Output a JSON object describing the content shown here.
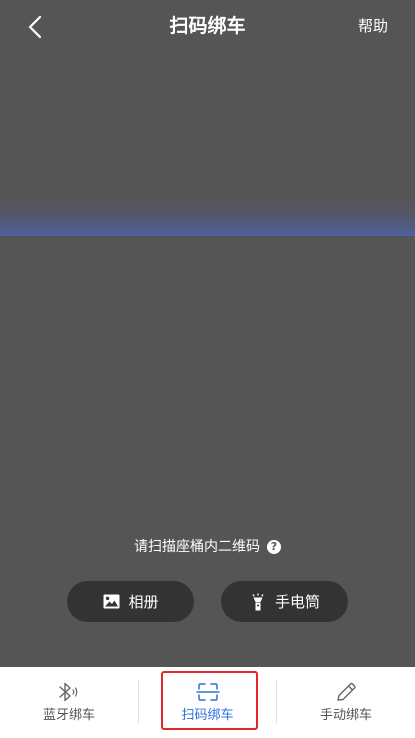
{
  "header": {
    "title": "扫码绑车",
    "help_label": "帮助"
  },
  "scan": {
    "hint": "请扫描座桶内二维码",
    "hint_icon_glyph": "?"
  },
  "actions": {
    "album_label": "相册",
    "torch_label": "手电筒"
  },
  "tabbar": {
    "items": [
      {
        "label": "蓝牙绑车",
        "icon": "bluetooth-icon",
        "active": false
      },
      {
        "label": "扫码绑车",
        "icon": "scan-icon",
        "active": true
      },
      {
        "label": "手动绑车",
        "icon": "pencil-icon",
        "active": false
      }
    ]
  },
  "colors": {
    "camera_background": "#555555",
    "button_background": "#333333",
    "active_tab": "#2f6fe0",
    "inactive_tab": "#555555",
    "highlight_border": "#e5262a",
    "scan_line": "#4f63a3"
  }
}
